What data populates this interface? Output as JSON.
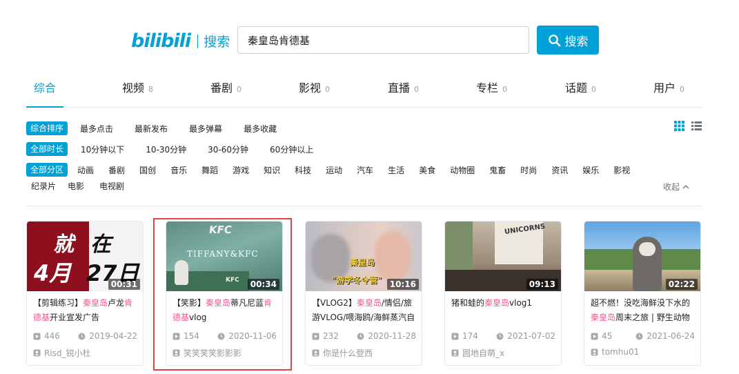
{
  "brand": {
    "logo": "bilibili",
    "section": "搜索"
  },
  "search": {
    "value": "秦皇岛肯德基",
    "button_label": "搜索"
  },
  "tabs": [
    {
      "label": "综合",
      "count": ""
    },
    {
      "label": "视频",
      "count": "8"
    },
    {
      "label": "番剧",
      "count": "0"
    },
    {
      "label": "影视",
      "count": "0"
    },
    {
      "label": "直播",
      "count": "0"
    },
    {
      "label": "专栏",
      "count": "0"
    },
    {
      "label": "话题",
      "count": "0"
    },
    {
      "label": "用户",
      "count": "0"
    }
  ],
  "filters": {
    "sort": {
      "active": "综合排序",
      "options": [
        "最多点击",
        "最新发布",
        "最多弹幕",
        "最多收藏"
      ]
    },
    "duration": {
      "active": "全部时长",
      "options": [
        "10分钟以下",
        "10-30分钟",
        "30-60分钟",
        "60分钟以上"
      ]
    },
    "zone": {
      "active": "全部分区",
      "options": [
        "动画",
        "番剧",
        "国创",
        "音乐",
        "舞蹈",
        "游戏",
        "知识",
        "科技",
        "运动",
        "汽车",
        "生活",
        "美食",
        "动物圈",
        "鬼畜",
        "时尚",
        "资讯",
        "娱乐",
        "影视"
      ],
      "options_row2": [
        "纪录片",
        "电影",
        "电视剧"
      ]
    },
    "collapse_label": "收起"
  },
  "videos": [
    {
      "duration": "00:31",
      "thumb_text": [
        "就",
        "在",
        "4月",
        "27日"
      ],
      "title_parts": [
        "【剪辑练习】",
        "秦皇岛",
        "卢龙",
        "肯德基",
        "开业宣发广告"
      ],
      "plays": "446",
      "date": "2019-04-22",
      "uploader": "Risd_锐小杜"
    },
    {
      "duration": "00:34",
      "thumb_text": [
        "KFC",
        "TIFFANY&KFC",
        "KFC"
      ],
      "title_parts": [
        "【笑影】",
        "秦皇岛",
        "蒂凡尼蓝",
        "肯德基",
        "vlog"
      ],
      "plays": "154",
      "date": "2020-11-06",
      "uploader": "笑笑笑笑影影影"
    },
    {
      "duration": "10:16",
      "thumb_text": [
        "秦皇岛",
        "\"游学冬令营\""
      ],
      "title_parts": [
        "【VLOG2】",
        "秦皇岛",
        "/情侣/旅游VLOG/喂海鸥/海鲜蒸汽自",
        "",
        ""
      ],
      "plays": "232",
      "date": "2020-11-28",
      "uploader": "你是什么登西"
    },
    {
      "duration": "09:13",
      "thumb_text": [
        "UNICORNS"
      ],
      "title_parts": [
        "猪和蛙的",
        "秦皇岛",
        "vlog1",
        "",
        ""
      ],
      "plays": "174",
      "date": "2021-07-02",
      "uploader": "圆地自萌_x"
    },
    {
      "duration": "02:22",
      "thumb_text": [],
      "title_parts": [
        "超不燃！没吃海鲜没下水的",
        "秦皇岛",
        "周末之旅 | 野生动物",
        "",
        ""
      ],
      "plays": "45",
      "date": "2021-06-24",
      "uploader": "tomhu01"
    }
  ]
}
